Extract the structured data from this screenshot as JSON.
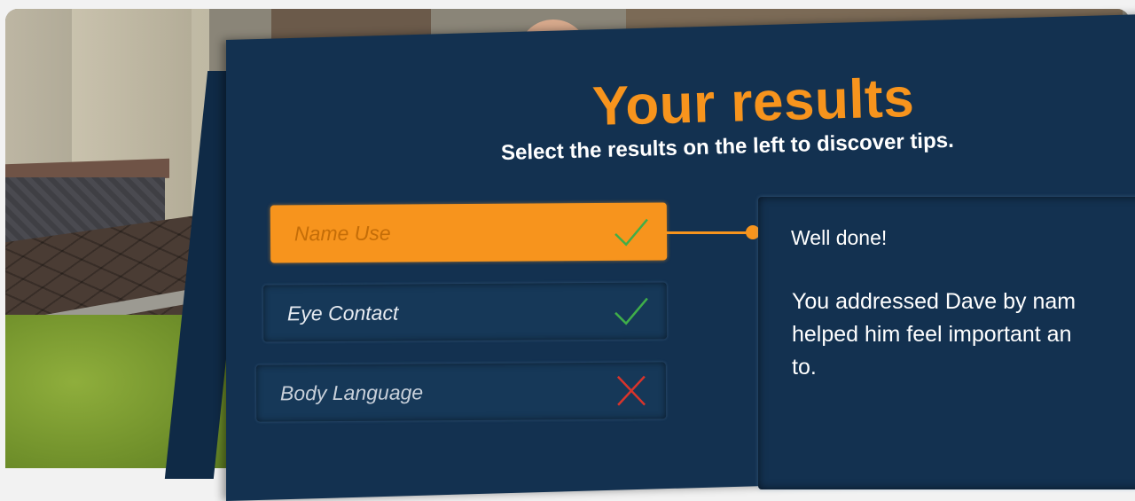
{
  "title": "Your results",
  "subtitle": "Select the results on the left to discover tips.",
  "results": [
    {
      "label": "Name Use",
      "status": "pass",
      "icon": "check-icon",
      "selected": true
    },
    {
      "label": "Eye Contact",
      "status": "pass",
      "icon": "check-icon",
      "selected": false
    },
    {
      "label": "Body Language",
      "status": "fail",
      "icon": "cross-icon",
      "selected": false
    }
  ],
  "tip": {
    "heading": "Well done!",
    "body_lines": [
      "You addressed Dave by nam",
      "helped him feel important an",
      "to."
    ]
  },
  "colors": {
    "accent": "#f7941d",
    "panel": "#133150",
    "check": "#3fae49",
    "cross": "#d9342b"
  }
}
